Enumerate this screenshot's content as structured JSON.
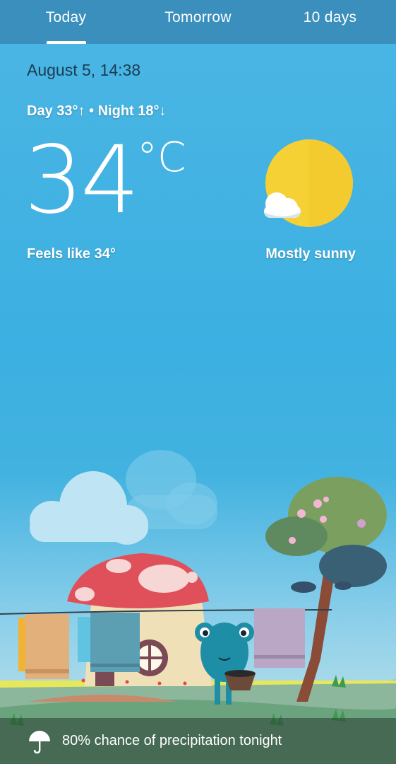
{
  "tabs": [
    {
      "label": "Today"
    },
    {
      "label": "Tomorrow"
    },
    {
      "label": "10 days"
    }
  ],
  "current": {
    "date_time": "August 5, 14:38",
    "day_night": "Day 33°↑ • Night 18°↓",
    "temperature": "34",
    "unit": "°C",
    "feels_like": "Feels like 34°",
    "condition": "Mostly sunny",
    "condition_icon": "sun-with-cloud-icon"
  },
  "footer": {
    "icon": "umbrella-icon",
    "precipitation": "80% chance of precipitation tonight"
  },
  "colors": {
    "sky": "#3cb0e2",
    "tab_bar": "#3a8fbd",
    "sun": "#f7d23a"
  }
}
